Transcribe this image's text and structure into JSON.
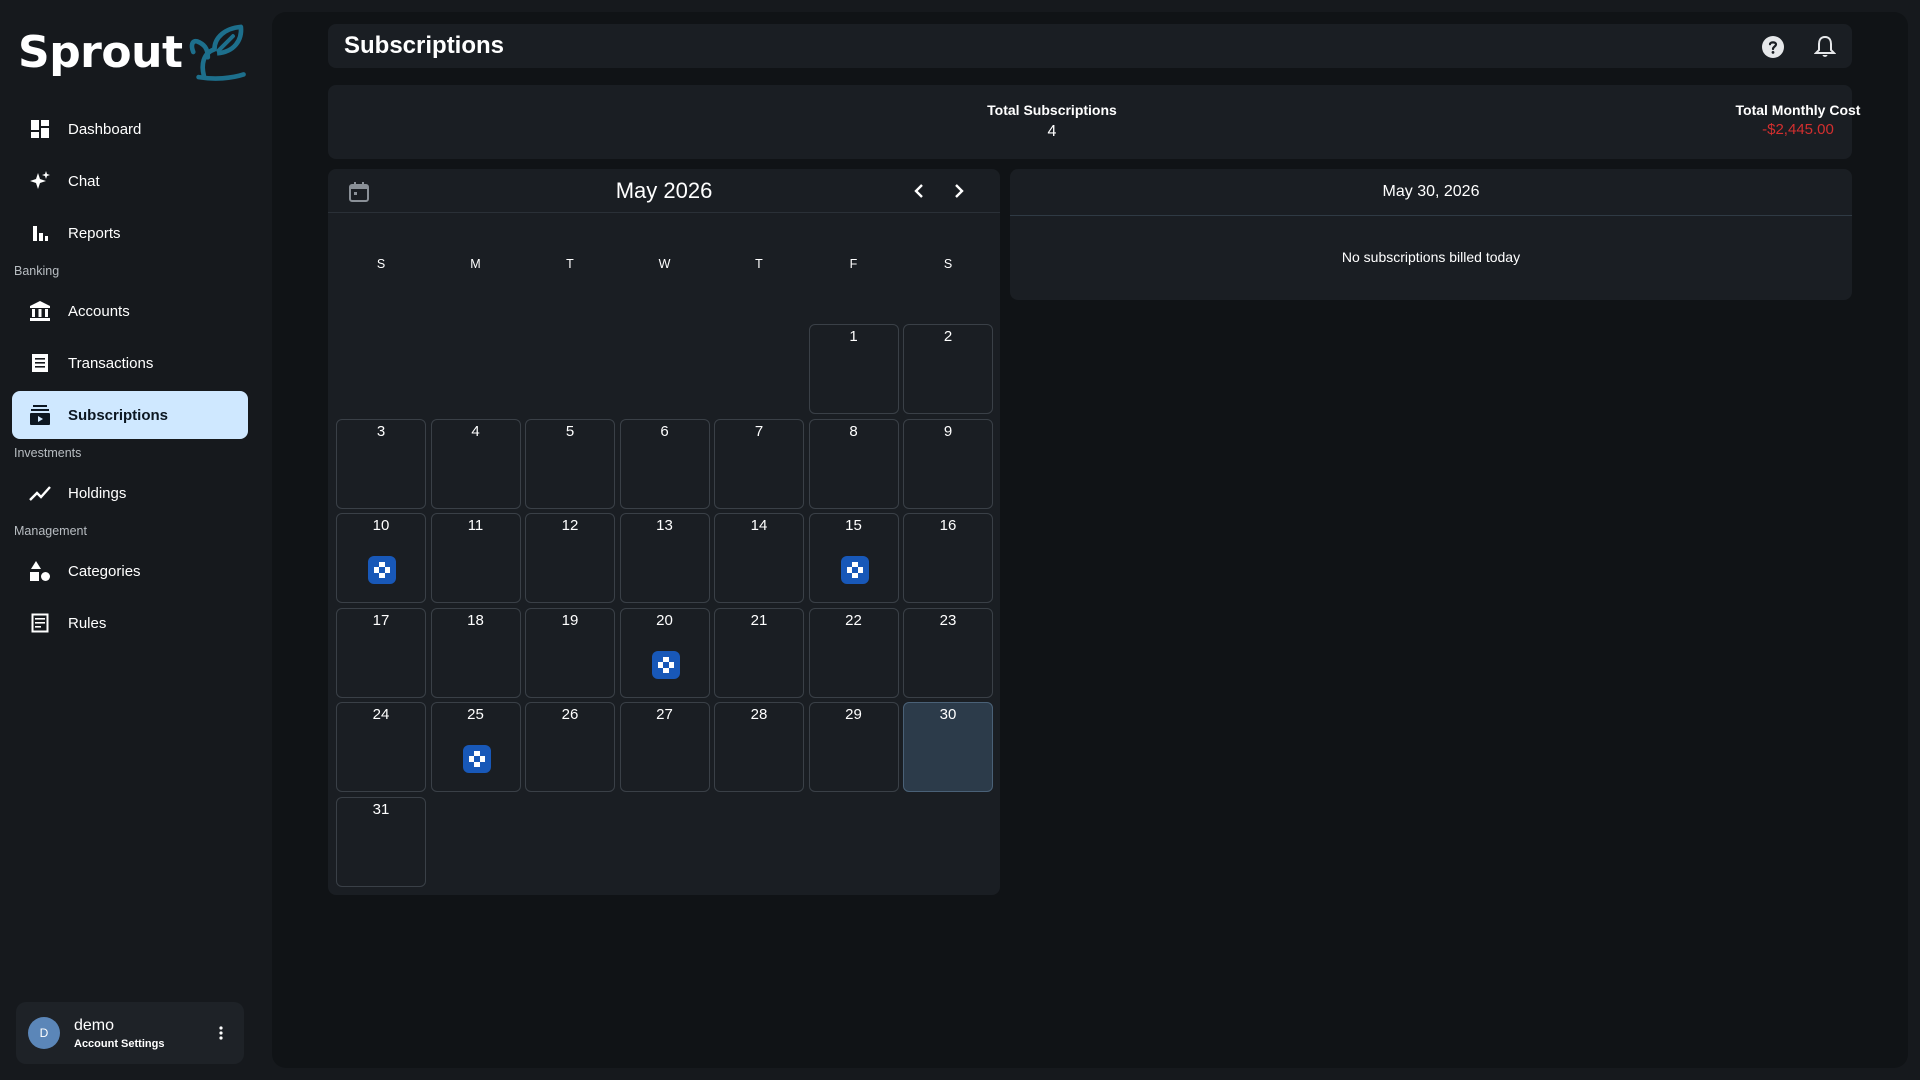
{
  "app": {
    "name": "Sprout"
  },
  "sidebar": {
    "items": [
      {
        "label": "Dashboard",
        "icon": "dashboard-icon"
      },
      {
        "label": "Chat",
        "icon": "sparkle-icon"
      },
      {
        "label": "Reports",
        "icon": "bar-chart-icon"
      }
    ],
    "sections": {
      "banking": "Banking",
      "investments": "Investments",
      "management": "Management"
    },
    "banking_items": [
      {
        "label": "Accounts",
        "icon": "bank-icon"
      },
      {
        "label": "Transactions",
        "icon": "receipt-icon"
      },
      {
        "label": "Subscriptions",
        "icon": "subscriptions-icon",
        "active": true
      }
    ],
    "investment_items": [
      {
        "label": "Holdings",
        "icon": "trending-up-icon"
      }
    ],
    "management_items": [
      {
        "label": "Categories",
        "icon": "categories-icon"
      },
      {
        "label": "Rules",
        "icon": "rules-icon"
      }
    ]
  },
  "user": {
    "initial": "D",
    "name": "demo",
    "subtitle": "Account Settings"
  },
  "header": {
    "title": "Subscriptions"
  },
  "stats": {
    "total_subscriptions_label": "Total Subscriptions",
    "total_subscriptions_value": "4",
    "total_monthly_cost_label": "Total Monthly Cost",
    "total_monthly_cost_value": "-$2,445.00"
  },
  "calendar": {
    "month_label": "May 2026",
    "weekdays": [
      "S",
      "M",
      "T",
      "W",
      "T",
      "F",
      "S"
    ],
    "leading_blanks": 5,
    "days_in_month": 31,
    "selected_day": 30,
    "subscription_days": [
      10,
      15,
      20,
      25
    ]
  },
  "detail": {
    "date_label": "May 30, 2026",
    "empty_message": "No subscriptions billed today"
  },
  "colors": {
    "accent_active": "#cfe8ff",
    "negative": "#d32f2f",
    "badge": "#1858b8",
    "logo_leaf": "#1d6f8c"
  }
}
